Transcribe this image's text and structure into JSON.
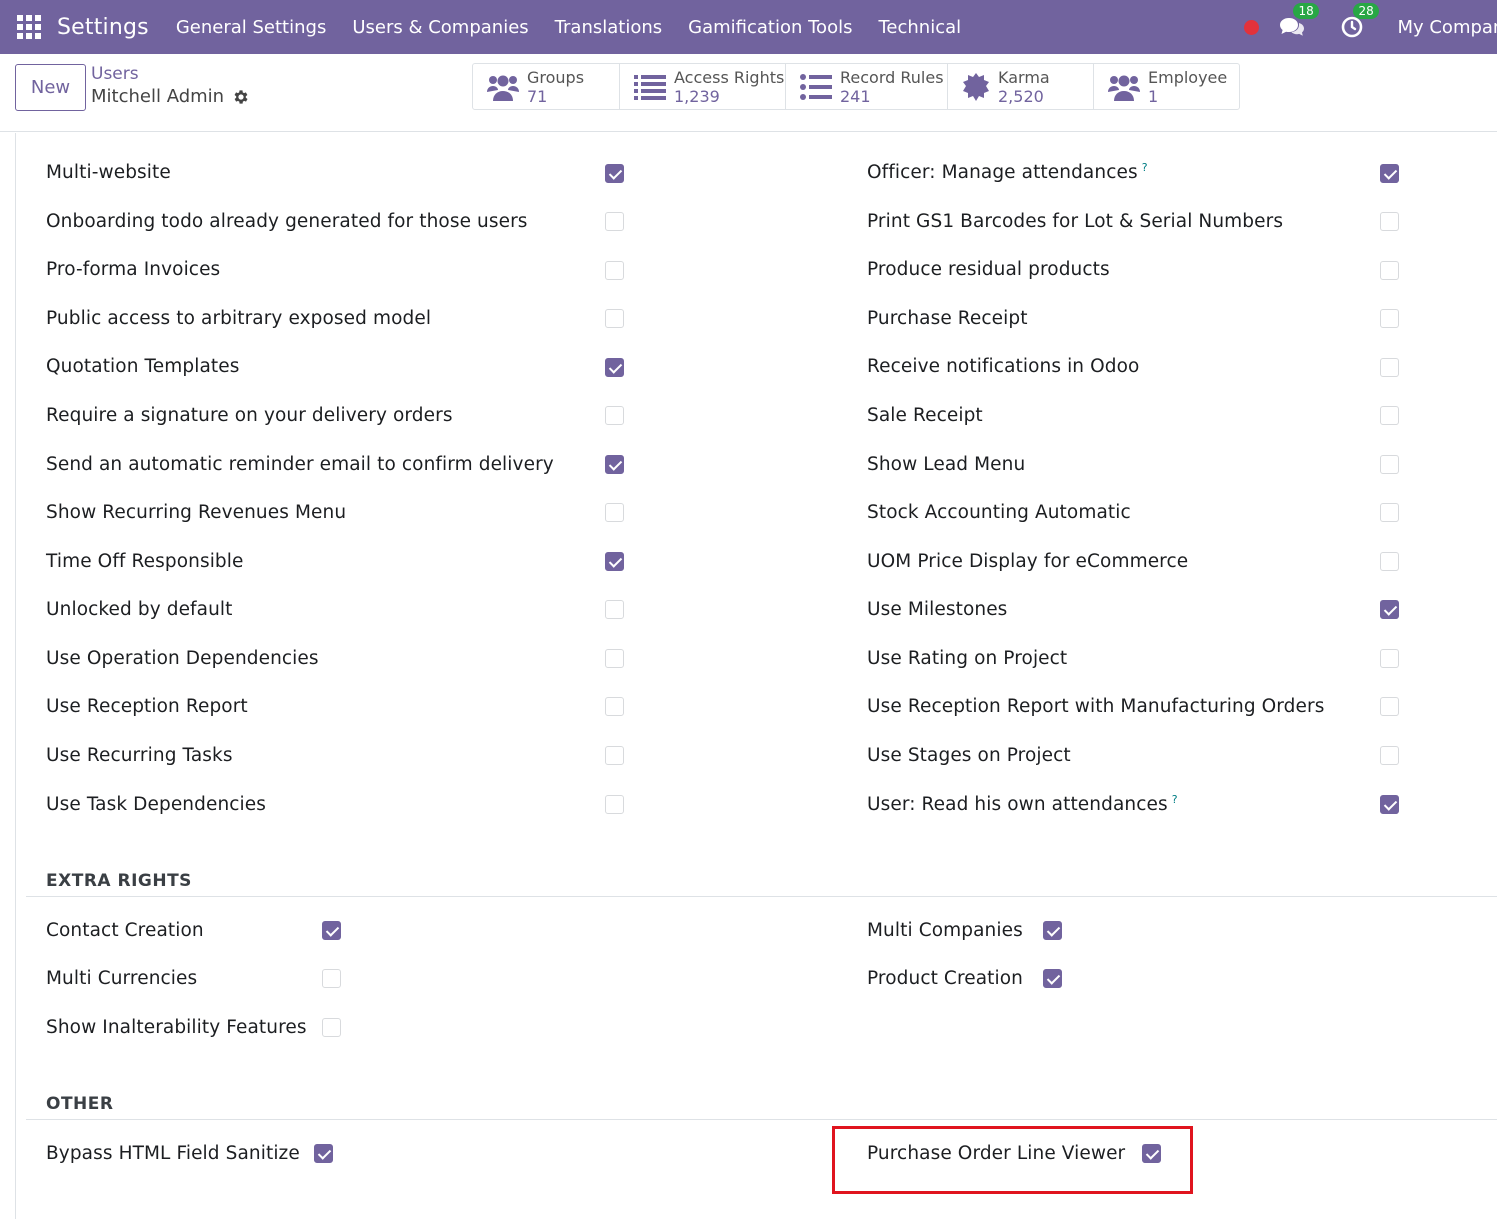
{
  "navbar": {
    "app_name": "Settings",
    "menu": [
      "General Settings",
      "Users & Companies",
      "Translations",
      "Gamification Tools",
      "Technical"
    ],
    "messages_count": "18",
    "activities_count": "28",
    "company": "My Company",
    "accent_color": "#71639e"
  },
  "control_panel": {
    "new_label": "New",
    "breadcrumb_parent": "Users",
    "breadcrumb_current": "Mitchell Admin",
    "smart_buttons": [
      {
        "label": "Groups",
        "value": "71",
        "icon": "users-icon"
      },
      {
        "label": "Access Rights",
        "value": "1,239",
        "icon": "list-icon"
      },
      {
        "label": "Record Rules",
        "value": "241",
        "icon": "list-icon"
      },
      {
        "label": "Karma",
        "value": "2,520",
        "icon": "badge-icon"
      },
      {
        "label": "Employee",
        "value": "1",
        "icon": "users-icon"
      }
    ]
  },
  "technical_rights": {
    "left": [
      {
        "label": "Multi-website",
        "checked": true
      },
      {
        "label": "Onboarding todo already generated for those users",
        "checked": false
      },
      {
        "label": "Pro-forma Invoices",
        "checked": false
      },
      {
        "label": "Public access to arbitrary exposed model",
        "checked": false
      },
      {
        "label": "Quotation Templates",
        "checked": true
      },
      {
        "label": "Require a signature on your delivery orders",
        "checked": false
      },
      {
        "label": "Send an automatic reminder email to confirm delivery",
        "checked": true
      },
      {
        "label": "Show Recurring Revenues Menu",
        "checked": false
      },
      {
        "label": "Time Off Responsible",
        "checked": true
      },
      {
        "label": "Unlocked by default",
        "checked": false
      },
      {
        "label": "Use Operation Dependencies",
        "checked": false
      },
      {
        "label": "Use Reception Report",
        "checked": false
      },
      {
        "label": "Use Recurring Tasks",
        "checked": false
      },
      {
        "label": "Use Task Dependencies",
        "checked": false
      }
    ],
    "right": [
      {
        "label": "Officer: Manage attendances",
        "checked": true,
        "help": "?"
      },
      {
        "label": "Print GS1 Barcodes for Lot & Serial Numbers",
        "checked": false
      },
      {
        "label": "Produce residual products",
        "checked": false
      },
      {
        "label": "Purchase Receipt",
        "checked": false
      },
      {
        "label": "Receive notifications in Odoo",
        "checked": false
      },
      {
        "label": "Sale Receipt",
        "checked": false
      },
      {
        "label": "Show Lead Menu",
        "checked": false
      },
      {
        "label": "Stock Accounting Automatic",
        "checked": false
      },
      {
        "label": "UOM Price Display for eCommerce",
        "checked": false
      },
      {
        "label": "Use Milestones",
        "checked": true
      },
      {
        "label": "Use Rating on Project",
        "checked": false
      },
      {
        "label": "Use Reception Report with Manufacturing Orders",
        "checked": false
      },
      {
        "label": "Use Stages on Project",
        "checked": false
      },
      {
        "label": "User: Read his own attendances",
        "checked": true,
        "help": "?"
      }
    ]
  },
  "extra_rights": {
    "title": "EXTRA RIGHTS",
    "left": [
      {
        "label": "Contact Creation",
        "checked": true
      },
      {
        "label": "Multi Currencies",
        "checked": false
      },
      {
        "label": "Show Inalterability Features",
        "checked": false
      }
    ],
    "right": [
      {
        "label": "Multi Companies",
        "checked": true
      },
      {
        "label": "Product Creation",
        "checked": true
      }
    ]
  },
  "other": {
    "title": "OTHER",
    "left": [
      {
        "label": "Bypass HTML Field Sanitize",
        "checked": true
      }
    ],
    "right": [
      {
        "label": "Purchase Order Line Viewer",
        "checked": true
      }
    ]
  }
}
